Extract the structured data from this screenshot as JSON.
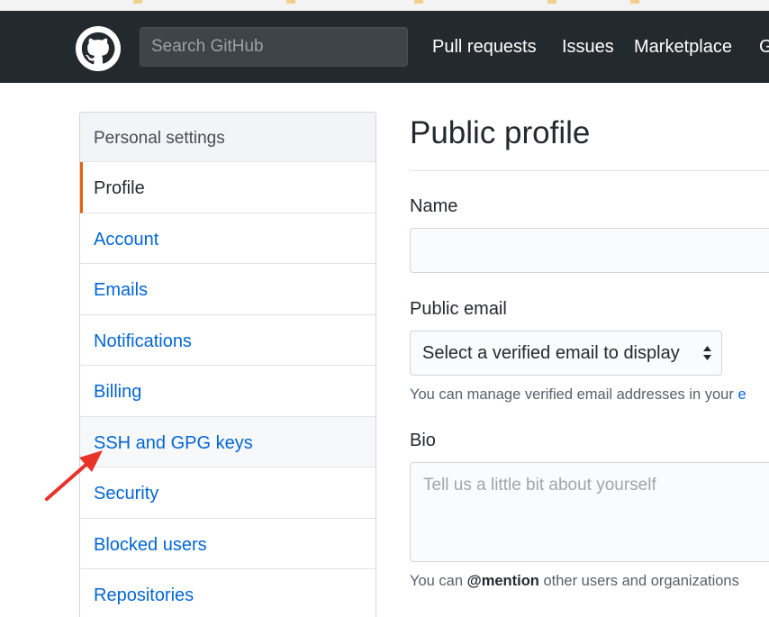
{
  "header": {
    "search_placeholder": "Search GitHub",
    "nav": [
      "Pull requests",
      "Issues",
      "Marketplace",
      "G"
    ]
  },
  "sidebar": {
    "heading": "Personal settings",
    "items": [
      {
        "label": "Profile",
        "selected": true
      },
      {
        "label": "Account"
      },
      {
        "label": "Emails"
      },
      {
        "label": "Notifications"
      },
      {
        "label": "Billing"
      },
      {
        "label": "SSH and GPG keys",
        "hover": true
      },
      {
        "label": "Security"
      },
      {
        "label": "Blocked users"
      },
      {
        "label": "Repositories"
      }
    ]
  },
  "main": {
    "title": "Public profile",
    "name_label": "Name",
    "public_email_label": "Public email",
    "email_select_value": "Select a verified email to display",
    "email_note": "You can manage verified email addresses in your ",
    "email_note_link": "e",
    "bio_label": "Bio",
    "bio_placeholder": "Tell us a little bit about yourself",
    "bio_note_prefix": "You can ",
    "bio_note_mention": "@mention",
    "bio_note_suffix": " other users and organizations"
  },
  "colors": {
    "header_bg": "#24292e",
    "link": "#0366d6",
    "selected_border": "#e36209",
    "annotation_arrow": "#e8322a"
  }
}
